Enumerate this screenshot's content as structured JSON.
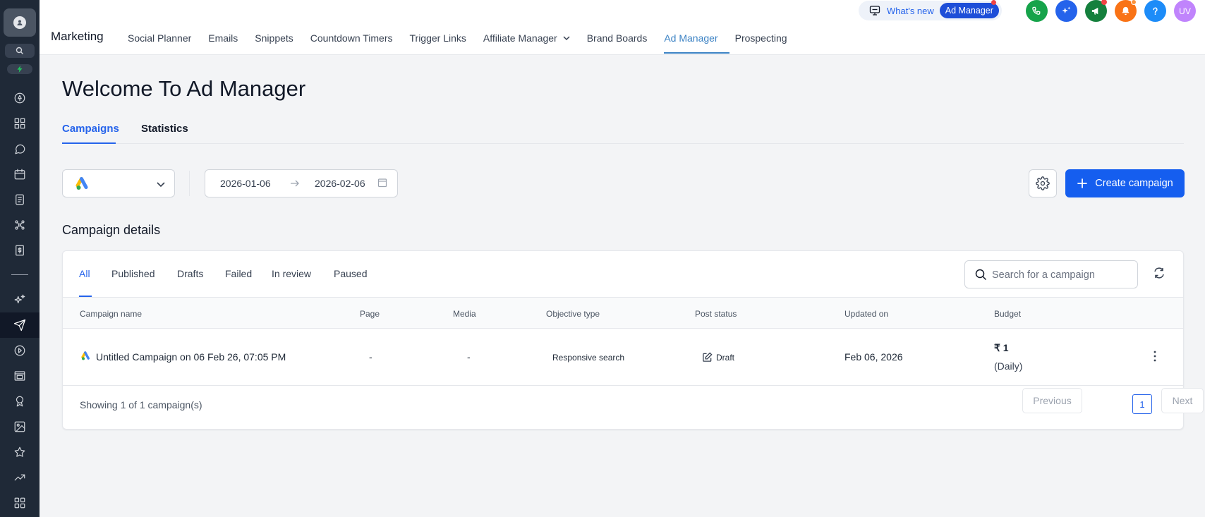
{
  "app": {
    "section": "Marketing",
    "nav": [
      {
        "label": "Social Planner"
      },
      {
        "label": "Emails"
      },
      {
        "label": "Snippets"
      },
      {
        "label": "Countdown Timers"
      },
      {
        "label": "Trigger Links"
      },
      {
        "label": "Affiliate Manager",
        "has_dropdown": true
      },
      {
        "label": "Brand Boards"
      },
      {
        "label": "Ad Manager",
        "active": true
      },
      {
        "label": "Prospecting"
      }
    ]
  },
  "header": {
    "whats_new": "What's new",
    "whats_new_pill": "Ad Manager",
    "user_initials": "UV",
    "circle_buttons": [
      {
        "icon": "phone-icon",
        "color": "#16a34a"
      },
      {
        "icon": "sparkle-icon",
        "color": "#2563eb"
      },
      {
        "icon": "megaphone-icon",
        "color": "#15803d"
      },
      {
        "icon": "bell-icon",
        "color": "#f97316"
      },
      {
        "icon": "help-icon",
        "color": "#1d8cf8"
      },
      {
        "icon": "avatar",
        "color": "#c084fc"
      }
    ]
  },
  "sidebar": {
    "icons": [
      "user-icon",
      "search-icon",
      "flash-icon",
      "rocket-icon",
      "dashboard-icon",
      "conversations-icon",
      "calendar-icon",
      "contacts-icon",
      "automation-icon",
      "payments-icon",
      "ai-sparkle-icon",
      "marketing-send-icon",
      "reporting-icon",
      "sites-icon",
      "reputation-icon",
      "media-icon",
      "favorites-icon",
      "trending-icon",
      "apps-icon"
    ]
  },
  "page": {
    "title": "Welcome To Ad Manager",
    "tabs": [
      {
        "label": "Campaigns",
        "active": true
      },
      {
        "label": "Statistics"
      }
    ],
    "date_start": "2026-01-06",
    "date_end": "2026-02-06",
    "create_label": "Create campaign",
    "section_title": "Campaign details"
  },
  "campaigns": {
    "filters": [
      "All",
      "Published",
      "Drafts",
      "Failed",
      "In review",
      "Paused"
    ],
    "search_placeholder": "Search for a campaign",
    "columns": [
      "Campaign name",
      "Page",
      "Media",
      "Objective type",
      "Post status",
      "Updated on",
      "Budget"
    ],
    "rows": [
      {
        "name": "Untitled Campaign on 06 Feb 26, 07:05 PM",
        "page": "-",
        "media": "-",
        "objective": "Responsive search",
        "status": "Draft",
        "updated": "Feb 06, 2026",
        "budget": "₹ 1",
        "budget_period": "(Daily)"
      }
    ],
    "showing": "Showing 1 of 1 campaign(s)",
    "pagination": {
      "previous": "Previous",
      "current": "1",
      "next": "Next"
    }
  },
  "colors": {
    "primary": "#155eef",
    "accent_tab": "#2563eb",
    "nav_active": "#3b82c4",
    "sidebar": "#1f2937"
  }
}
